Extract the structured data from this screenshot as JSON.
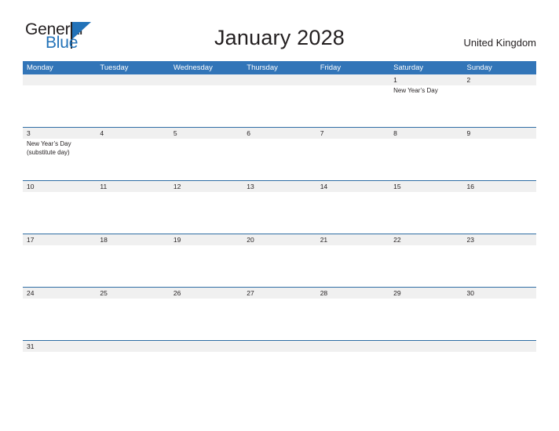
{
  "brand": {
    "name_part1": "General",
    "name_part2": "Blue",
    "logo_icon": "blue-triangle-flag-icon",
    "colors": {
      "blue": "#2272b8",
      "dark": "#231f20",
      "header_blue": "#3275b8",
      "row_border_blue": "#2e6da4",
      "date_strip_gray": "#f0f0f0"
    }
  },
  "header": {
    "title": "January 2028",
    "country": "United Kingdom"
  },
  "calendar": {
    "weekdays": [
      "Monday",
      "Tuesday",
      "Wednesday",
      "Thursday",
      "Friday",
      "Saturday",
      "Sunday"
    ],
    "weeks": [
      {
        "size": "tall",
        "days": [
          {
            "date": "",
            "events": []
          },
          {
            "date": "",
            "events": []
          },
          {
            "date": "",
            "events": []
          },
          {
            "date": "",
            "events": []
          },
          {
            "date": "",
            "events": []
          },
          {
            "date": "1",
            "events": [
              "New Year’s Day"
            ]
          },
          {
            "date": "2",
            "events": []
          }
        ]
      },
      {
        "size": "tall",
        "days": [
          {
            "date": "3",
            "events": [
              "New Year’s Day",
              "(substitute day)"
            ]
          },
          {
            "date": "4",
            "events": []
          },
          {
            "date": "5",
            "events": []
          },
          {
            "date": "6",
            "events": []
          },
          {
            "date": "7",
            "events": []
          },
          {
            "date": "8",
            "events": []
          },
          {
            "date": "9",
            "events": []
          }
        ]
      },
      {
        "size": "tall",
        "days": [
          {
            "date": "10",
            "events": []
          },
          {
            "date": "11",
            "events": []
          },
          {
            "date": "12",
            "events": []
          },
          {
            "date": "13",
            "events": []
          },
          {
            "date": "14",
            "events": []
          },
          {
            "date": "15",
            "events": []
          },
          {
            "date": "16",
            "events": []
          }
        ]
      },
      {
        "size": "tall",
        "days": [
          {
            "date": "17",
            "events": []
          },
          {
            "date": "18",
            "events": []
          },
          {
            "date": "19",
            "events": []
          },
          {
            "date": "20",
            "events": []
          },
          {
            "date": "21",
            "events": []
          },
          {
            "date": "22",
            "events": []
          },
          {
            "date": "23",
            "events": []
          }
        ]
      },
      {
        "size": "tall",
        "days": [
          {
            "date": "24",
            "events": []
          },
          {
            "date": "25",
            "events": []
          },
          {
            "date": "26",
            "events": []
          },
          {
            "date": "27",
            "events": []
          },
          {
            "date": "28",
            "events": []
          },
          {
            "date": "29",
            "events": []
          },
          {
            "date": "30",
            "events": []
          }
        ]
      },
      {
        "size": "short",
        "days": [
          {
            "date": "31",
            "events": []
          },
          {
            "date": "",
            "events": []
          },
          {
            "date": "",
            "events": []
          },
          {
            "date": "",
            "events": []
          },
          {
            "date": "",
            "events": []
          },
          {
            "date": "",
            "events": []
          },
          {
            "date": "",
            "events": []
          }
        ]
      }
    ]
  }
}
